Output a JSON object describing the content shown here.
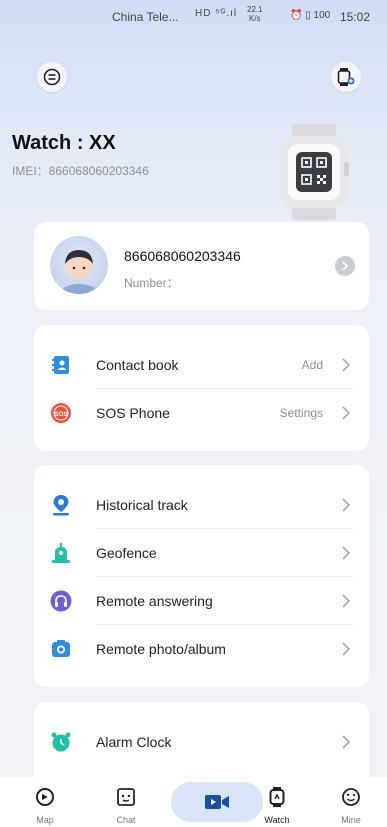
{
  "status_bar": {
    "carrier": "China Tele...",
    "signal": "HD ⁵ᴳ.ıl",
    "net_speed_value": "22.1",
    "net_speed_unit": "K/s",
    "right_icons": "⏰ ▯ 100",
    "time": "15:02"
  },
  "header": {
    "title": "Watch : XX",
    "imei": "IMEI：866068060203346"
  },
  "profile": {
    "id": "866068060203346",
    "number_label": "Number："
  },
  "contacts_section": {
    "items": [
      {
        "label": "Contact book",
        "value": "Add",
        "icon": "contact-book-icon"
      },
      {
        "label": "SOS Phone",
        "value": "Settings",
        "icon": "sos-icon"
      }
    ]
  },
  "features_section": {
    "items": [
      {
        "label": "Historical track",
        "icon": "location-pin-icon"
      },
      {
        "label": "Geofence",
        "icon": "geofence-icon"
      },
      {
        "label": "Remote answering",
        "icon": "headset-icon"
      },
      {
        "label": "Remote photo/album",
        "icon": "camera-icon"
      }
    ]
  },
  "alarm_section": {
    "items": [
      {
        "label": "Alarm Clock",
        "icon": "alarm-clock-icon"
      }
    ]
  },
  "tab_bar": {
    "tabs": [
      {
        "label": "Map",
        "icon": "map-icon"
      },
      {
        "label": "Chat",
        "icon": "chat-icon"
      },
      {
        "label": "Watch",
        "icon": "watch-icon",
        "active": true
      },
      {
        "label": "Mine",
        "icon": "smiley-icon"
      }
    ]
  },
  "colors": {
    "accent_blue": "#2a6fd6",
    "sos_red": "#e8553f",
    "geofence_green": "#22c1a6",
    "headset_purple": "#6a61d8",
    "camera_blue": "#2d8ee0"
  }
}
